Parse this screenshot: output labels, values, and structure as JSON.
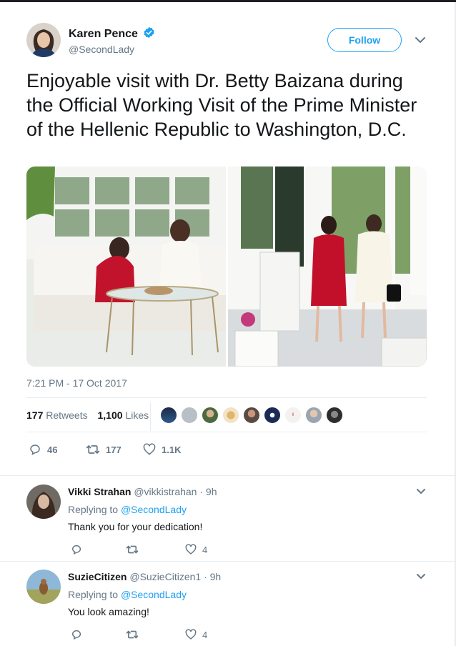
{
  "tweet": {
    "author_name": "Karen Pence",
    "author_handle": "@SecondLady",
    "follow_label": "Follow",
    "text": "Enjoyable visit with Dr. Betty Baizana during the Official Working Visit of the Prime Minister of the Hellenic Republic to Washington, D.C.",
    "timestamp": "7:21 PM - 17 Oct 2017",
    "retweets_count": "177",
    "retweets_label": "Retweets",
    "likes_count": "1,100",
    "likes_label": "Likes",
    "actions": {
      "replies": "46",
      "retweets": "177",
      "likes": "1.1K"
    }
  },
  "replies": [
    {
      "name": "Vikki Strahan",
      "handle": "@vikkistrahan",
      "time": "· 9h",
      "replying_prefix": "Replying to",
      "replying_to": "@SecondLady",
      "text": "Thank you for your dedication!",
      "likes": "4"
    },
    {
      "name": "SuzieCitizen",
      "handle": "@SuzieCitizen1",
      "time": "· 9h",
      "replying_prefix": "Replying to",
      "replying_to": "@SecondLady",
      "text": "You look amazing!",
      "likes": "4"
    }
  ],
  "colors": {
    "accent": "#1da1f2",
    "text": "#14171a",
    "muted": "#657786",
    "divider": "#e6ecf0"
  },
  "icons": [
    "verified-badge-icon",
    "chevron-down-icon",
    "reply-icon",
    "retweet-icon",
    "heart-icon"
  ]
}
